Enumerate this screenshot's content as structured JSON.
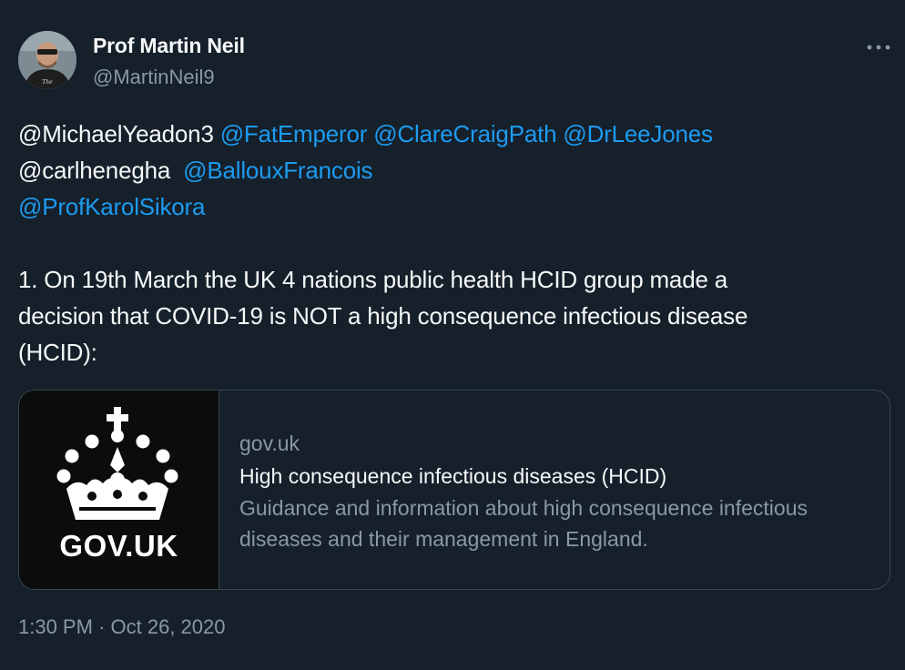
{
  "author": {
    "name": "Prof Martin Neil",
    "handle": "@MartinNeil9"
  },
  "tweet": {
    "line1": {
      "mention1": "@MichaelYeadon3",
      "mention2": "@FatEmperor",
      "mention3": "@ClareCraigPath",
      "mention4": "@DrLeeJones"
    },
    "line2": {
      "mention5": "@carlhenegha",
      "mention6": "@BallouxFrancois"
    },
    "line3": {
      "mention7": "@ProfKarolSikora"
    },
    "paragraph": [
      "1. On 19th March the UK 4 nations public health HCID group made a",
      "decision that  COVID-19 is NOT a high consequence infectious disease",
      "(HCID):"
    ]
  },
  "card": {
    "logo_text": "GOV.UK",
    "domain": "gov.uk",
    "title": "High consequence infectious diseases (HCID)",
    "description": "Guidance and information about high consequence infectious diseases and their management in England."
  },
  "timestamp": {
    "time": "1:30 PM",
    "separator": "·",
    "date": "Oct 26, 2020"
  },
  "colors": {
    "background": "#15202b",
    "text": "#f7f9f9",
    "muted": "#8b98a5",
    "link": "#1d9bf0",
    "border": "#38444d"
  },
  "icons": {
    "more": "more-horizontal-icon",
    "crown": "crown-icon"
  }
}
